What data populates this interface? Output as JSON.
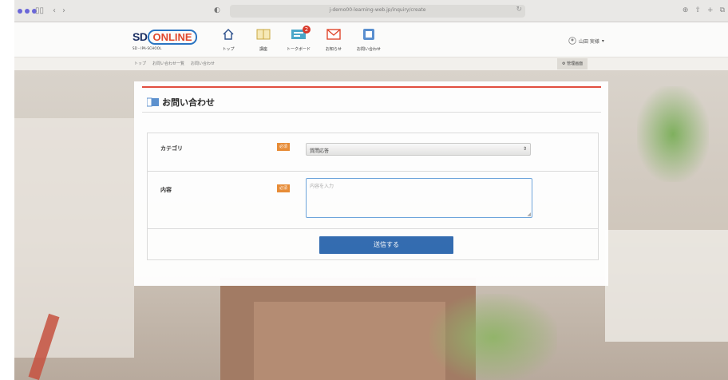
{
  "browser": {
    "url": "j-demo00-learning-web.jp/inquiry/create"
  },
  "header": {
    "logo_sd": "SD",
    "logo_online": "ONLINE",
    "logo_sub": "SD・IPA-SCHOOL",
    "nav": [
      {
        "label": "トップ",
        "icon": "home-icon"
      },
      {
        "label": "講座",
        "icon": "book-icon"
      },
      {
        "label": "トークボード",
        "icon": "board-icon",
        "badge": "2"
      },
      {
        "label": "お知らせ",
        "icon": "mail-icon"
      },
      {
        "label": "お問い合わせ",
        "icon": "inquiry-icon"
      }
    ],
    "user_name": "山田 実様"
  },
  "breadcrumb": {
    "items": [
      "トップ",
      "お問い合わせ一覧",
      "お問い合わせ"
    ],
    "admin_label": "管理画面"
  },
  "form": {
    "title": "お問い合わせ",
    "category_label": "カテゴリ",
    "content_label": "内容",
    "required_label": "必須",
    "category_value": "質問応答",
    "content_placeholder": "内容を入力",
    "submit_label": "送信する"
  },
  "colors": {
    "accent_red": "#e24a3b",
    "button_blue": "#2f6ab0",
    "required_orange": "#e88a33",
    "chrome_dot": "#6b67d8"
  }
}
